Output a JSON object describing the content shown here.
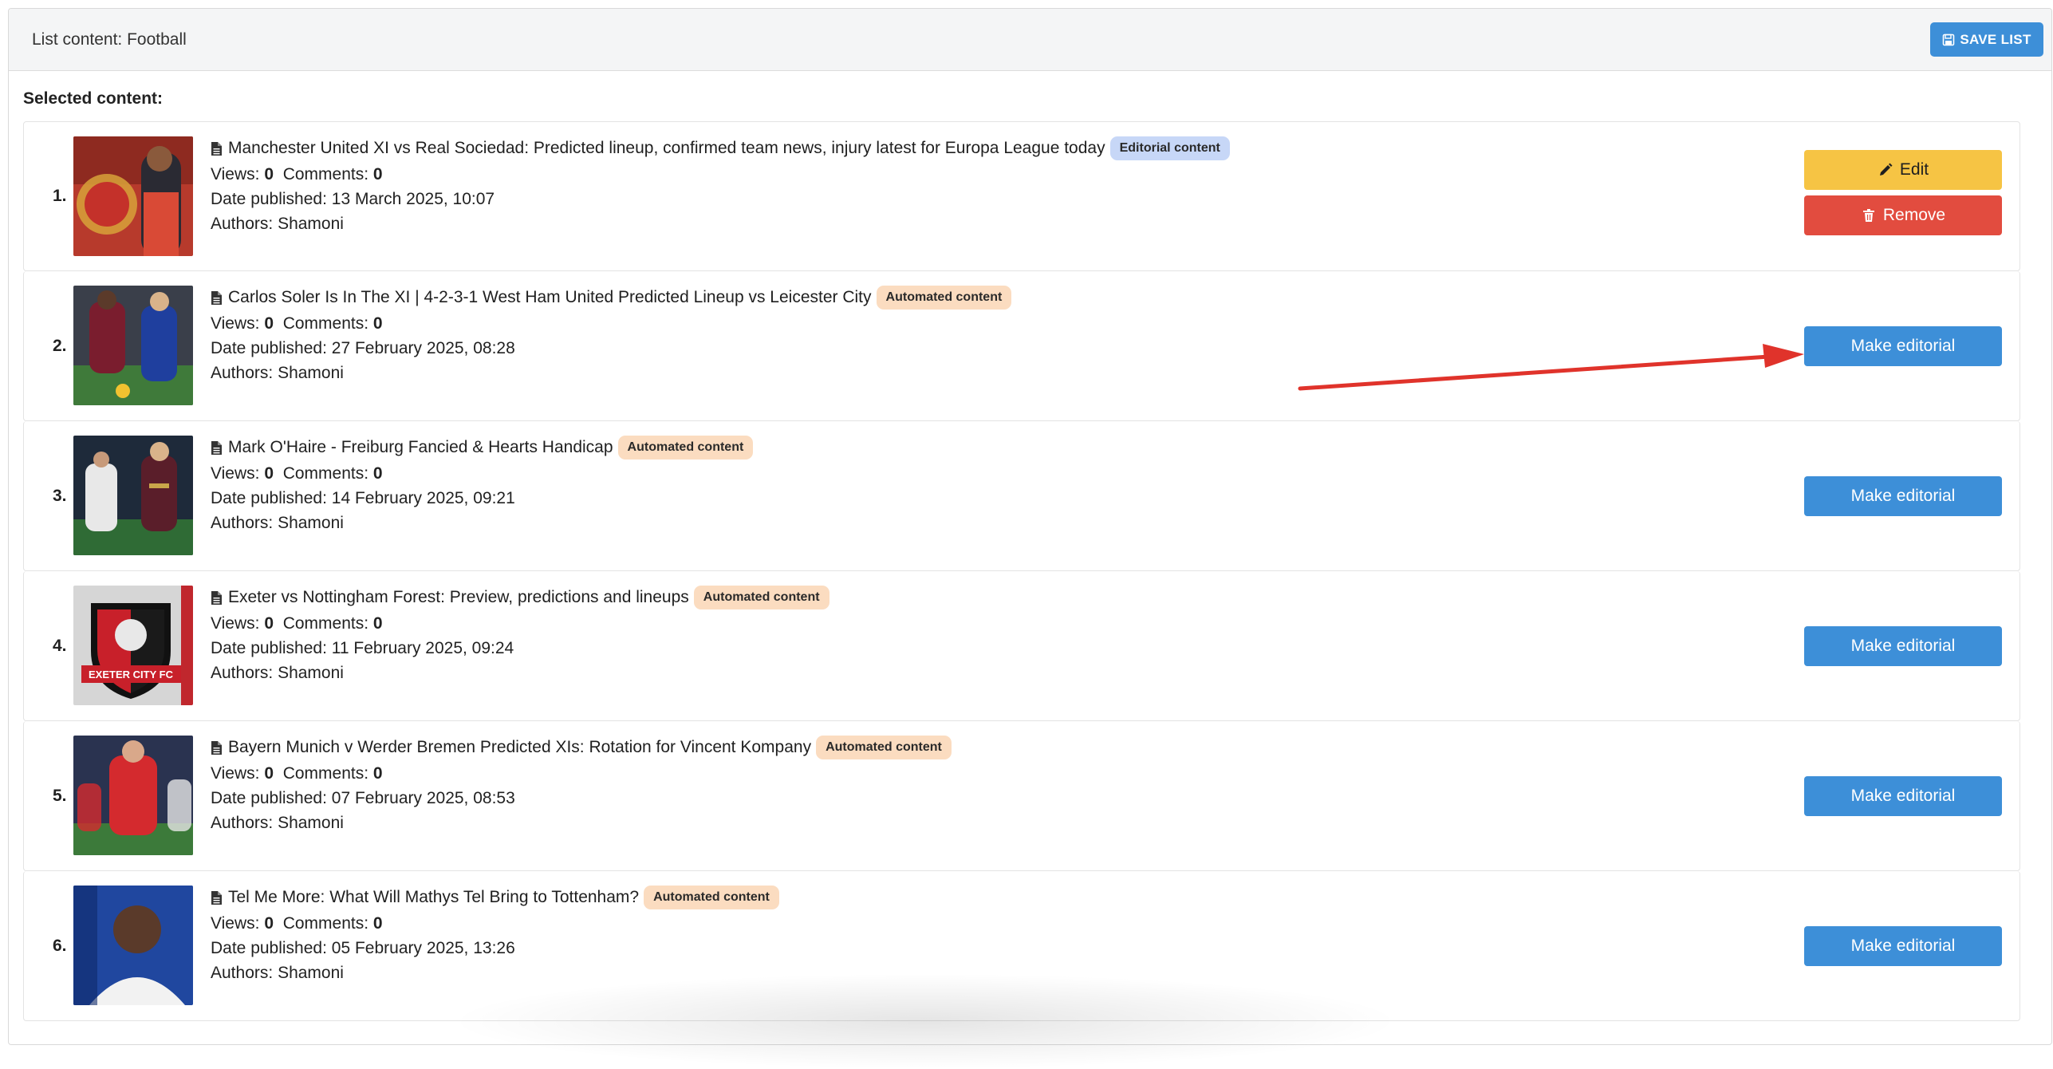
{
  "header": {
    "title": "List content: Football",
    "save_label": "SAVE LIST"
  },
  "section_label": "Selected content:",
  "labels": {
    "views": "Views:",
    "comments": "Comments:",
    "date_published": "Date published:",
    "authors": "Authors:"
  },
  "buttons": {
    "edit": "Edit",
    "remove": "Remove",
    "make_editorial": "Make editorial"
  },
  "items": [
    {
      "number": "1.",
      "title": "Manchester United XI vs Real Sociedad: Predicted lineup, confirmed team news, injury latest for Europa League today",
      "badge": "Editorial content",
      "views": "0",
      "comments": "0",
      "date": "13 March 2025, 10:07",
      "authors": "Shamoni"
    },
    {
      "number": "2.",
      "title": "Carlos Soler Is In The XI | 4-2-3-1 West Ham United Predicted Lineup vs Leicester City",
      "badge": "Automated content",
      "views": "0",
      "comments": "0",
      "date": "27 February 2025, 08:28",
      "authors": "Shamoni"
    },
    {
      "number": "3.",
      "title": "Mark O'Haire - Freiburg Fancied & Hearts Handicap",
      "badge": "Automated content",
      "views": "0",
      "comments": "0",
      "date": "14 February 2025, 09:21",
      "authors": "Shamoni"
    },
    {
      "number": "4.",
      "title": "Exeter vs Nottingham Forest: Preview, predictions and lineups",
      "badge": "Automated content",
      "views": "0",
      "comments": "0",
      "date": "11 February 2025, 09:24",
      "authors": "Shamoni",
      "thumb_text": "EXETER CITY FC"
    },
    {
      "number": "5.",
      "title": "Bayern Munich v Werder Bremen Predicted XIs: Rotation for Vincent Kompany",
      "badge": "Automated content",
      "views": "0",
      "comments": "0",
      "date": "07 February 2025, 08:53",
      "authors": "Shamoni"
    },
    {
      "number": "6.",
      "title": "Tel Me More: What Will Mathys Tel Bring to Tottenham?",
      "badge": "Automated content",
      "views": "0",
      "comments": "0",
      "date": "05 February 2025, 13:26",
      "authors": "Shamoni"
    }
  ],
  "colors": {
    "primary": "#3d8fd8",
    "edit": "#f6c444",
    "remove": "#e24c3f",
    "annotation_arrow": "#e0332b"
  }
}
